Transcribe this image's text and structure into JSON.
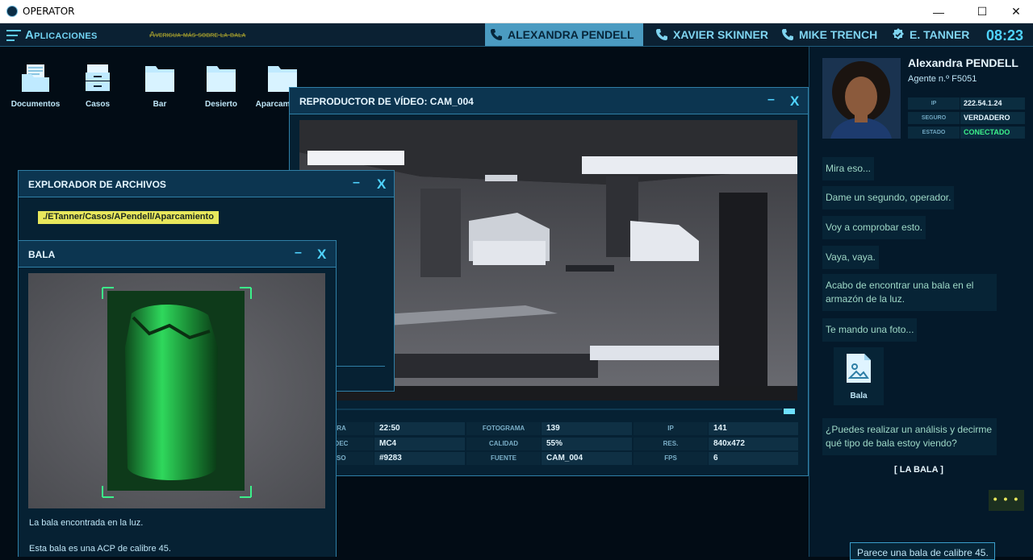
{
  "window": {
    "title": "OPERATOR",
    "minimize": "—",
    "maximize": "☐",
    "close": "✕"
  },
  "topbar": {
    "apps_label": "Aplicaciones",
    "objective": "Averigua más sobre la bala",
    "contacts": [
      {
        "name": "ALEXANDRA PENDELL",
        "active": true,
        "icon": "phone-icon"
      },
      {
        "name": "XAVIER SKINNER",
        "active": false,
        "icon": "phone-icon"
      },
      {
        "name": "MIKE TRENCH",
        "active": false,
        "icon": "phone-icon"
      },
      {
        "name": "E. TANNER",
        "active": false,
        "icon": "badge-icon"
      }
    ],
    "clock": "08:23"
  },
  "desktop": {
    "icons": [
      {
        "label": "Documentos",
        "icon": "folder-documents-icon"
      },
      {
        "label": "Casos",
        "icon": "cabinet-icon"
      },
      {
        "label": "Bar",
        "icon": "folder-icon"
      },
      {
        "label": "Desierto",
        "icon": "folder-icon"
      },
      {
        "label": "Aparcamiento",
        "icon": "folder-icon"
      }
    ]
  },
  "video_window": {
    "title": "REPRODUCTOR DE VÍDEO: CAM_004",
    "stats": [
      {
        "key": "HORA",
        "value": "22:50"
      },
      {
        "key": "FOTOGRAMA",
        "value": "139"
      },
      {
        "key": "IP",
        "value": "141"
      },
      {
        "key": "CÓDEC",
        "value": "MC4"
      },
      {
        "key": "CALIDAD",
        "value": "55%"
      },
      {
        "key": "RES.",
        "value": "840x472"
      },
      {
        "key": "CASO",
        "value": "#9283"
      },
      {
        "key": "FUENTE",
        "value": "CAM_004"
      },
      {
        "key": "FPS",
        "value": "6"
      }
    ],
    "progress": 0.98
  },
  "file_explorer": {
    "title": "EXPLORADOR DE ARCHIVOS",
    "path": "./ETanner/Casos/APendell/Aparcamiento"
  },
  "bala_window": {
    "title": "BALA",
    "caption1": "La bala encontrada en la luz.",
    "caption2": "Esta bala es una ACP de calibre 45."
  },
  "agent": {
    "name": "Alexandra PENDELL",
    "number": "Agente n.º F5051",
    "info": [
      {
        "key": "IP",
        "value": "222.54.1.24"
      },
      {
        "key": "SEGURO",
        "value": "VERDADERO"
      },
      {
        "key": "ESTADO",
        "value": "CONECTADO"
      }
    ],
    "status_color": "#3cf08a"
  },
  "chat": {
    "messages": [
      "Mira eso...",
      "Dame un segundo, operador.",
      "Voy a comprobar esto.",
      "Vaya, vaya.",
      "Acabo de encontrar una bala en el armazón de la luz.",
      "Te mando una foto...",
      "¿Puedes realizar un análisis y decirme qué tipo de bala estoy viendo?"
    ],
    "attachment_label": "Bala",
    "choice": "[    LA BALA    ]",
    "typing": "• • •",
    "reply": "Parece una bala de calibre 45."
  },
  "colors": {
    "accent": "#4fd3ff",
    "highlight": "#e8e75c",
    "bg": "#020c15"
  }
}
